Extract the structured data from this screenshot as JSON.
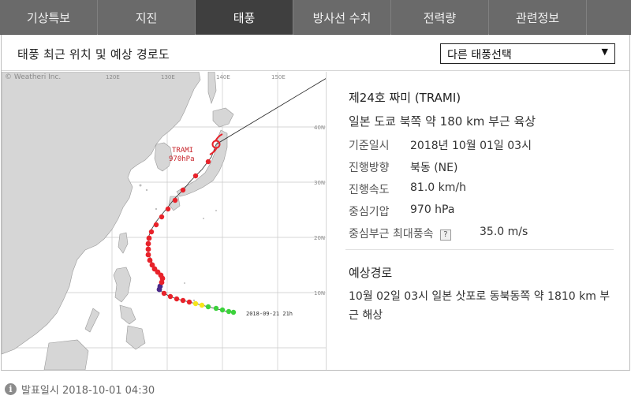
{
  "tabs": [
    {
      "label": "기상특보"
    },
    {
      "label": "지진"
    },
    {
      "label": "태풍"
    },
    {
      "label": "방사선 수치"
    },
    {
      "label": "전력량"
    },
    {
      "label": "관련정보"
    }
  ],
  "panel": {
    "title": "태풍 최근 위치 및 예상 경로도",
    "select": {
      "value": "다른 태풍선택",
      "arrow": "▼"
    }
  },
  "map": {
    "copyright": "© Weatheri Inc.",
    "lon_labels": [
      "120E",
      "130E",
      "140E",
      "150E"
    ],
    "lat_labels": [
      "40N",
      "30N",
      "20N",
      "10N"
    ],
    "storm_label": "TRAMI",
    "pressure_label": "970hPa",
    "start_label": "2018-09-21 21h",
    "colors": {
      "land": "#d8d8d8",
      "sea": "#ffffff",
      "track_red": "#e8222a",
      "track_purple": "#4a2a8a",
      "track_yellow": "#f5e61a",
      "track_green": "#3cd23c",
      "forecast_line": "#222222"
    }
  },
  "info": {
    "name": "제24호 짜미 (TRAMI)",
    "status": "일본 도쿄 북쪽 약 180 km 부근 육상",
    "rows": [
      {
        "label": "기준일시",
        "value": "2018년 10월 01일 03시"
      },
      {
        "label": "진행방향",
        "value": "북동 (NE)"
      },
      {
        "label": "진행속도",
        "value": "81.0 km/h"
      },
      {
        "label": "중심기압",
        "value": "970 hPa"
      }
    ],
    "wind": {
      "label": "중심부근 최대풍속",
      "help": "?",
      "value": "35.0 m/s"
    },
    "forecast_title": "예상경로",
    "forecast_text": "10월 02일 03시 일본 삿포로 동북동쪽 약 1810 km 부근 해상"
  },
  "footer": {
    "icon": "i",
    "text": "발표일시 2018-10-01 04:30"
  }
}
